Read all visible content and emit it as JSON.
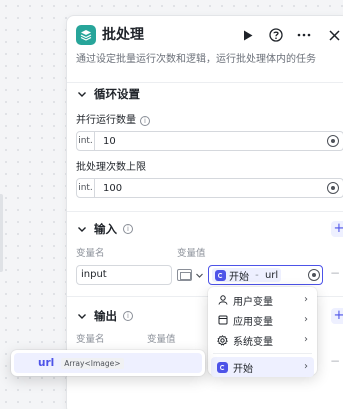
{
  "node": {
    "title": "批处理",
    "description": "通过设定批量运行次数和逻辑，运行批处理体内的任务"
  },
  "loop_settings": {
    "title": "循环设置",
    "parallel": {
      "label": "并行运行数量",
      "type": "int.",
      "value": "10"
    },
    "batch_limit": {
      "label": "批处理次数上限",
      "type": "int.",
      "value": "100"
    }
  },
  "input": {
    "title": "输入",
    "col_name": "变量名",
    "col_value": "变量值",
    "row": {
      "name": "input",
      "ref_source": "开始",
      "ref_sep": " - ",
      "ref_var": "url"
    }
  },
  "output": {
    "title": "输出",
    "col_name": "变量名",
    "col_value": "变量值"
  },
  "dropdown": {
    "items": [
      {
        "label": "用户变量",
        "icon": "user-icon"
      },
      {
        "label": "应用变量",
        "icon": "folder-icon"
      },
      {
        "label": "系统变量",
        "icon": "gear-icon"
      },
      {
        "label": "开始",
        "icon": "start-node-icon"
      }
    ]
  },
  "sub_dropdown": {
    "item": {
      "name": "url",
      "type": "Array<Image>"
    }
  },
  "colors": {
    "accent": "#4d53e8",
    "node_icon": "#27a59a"
  }
}
